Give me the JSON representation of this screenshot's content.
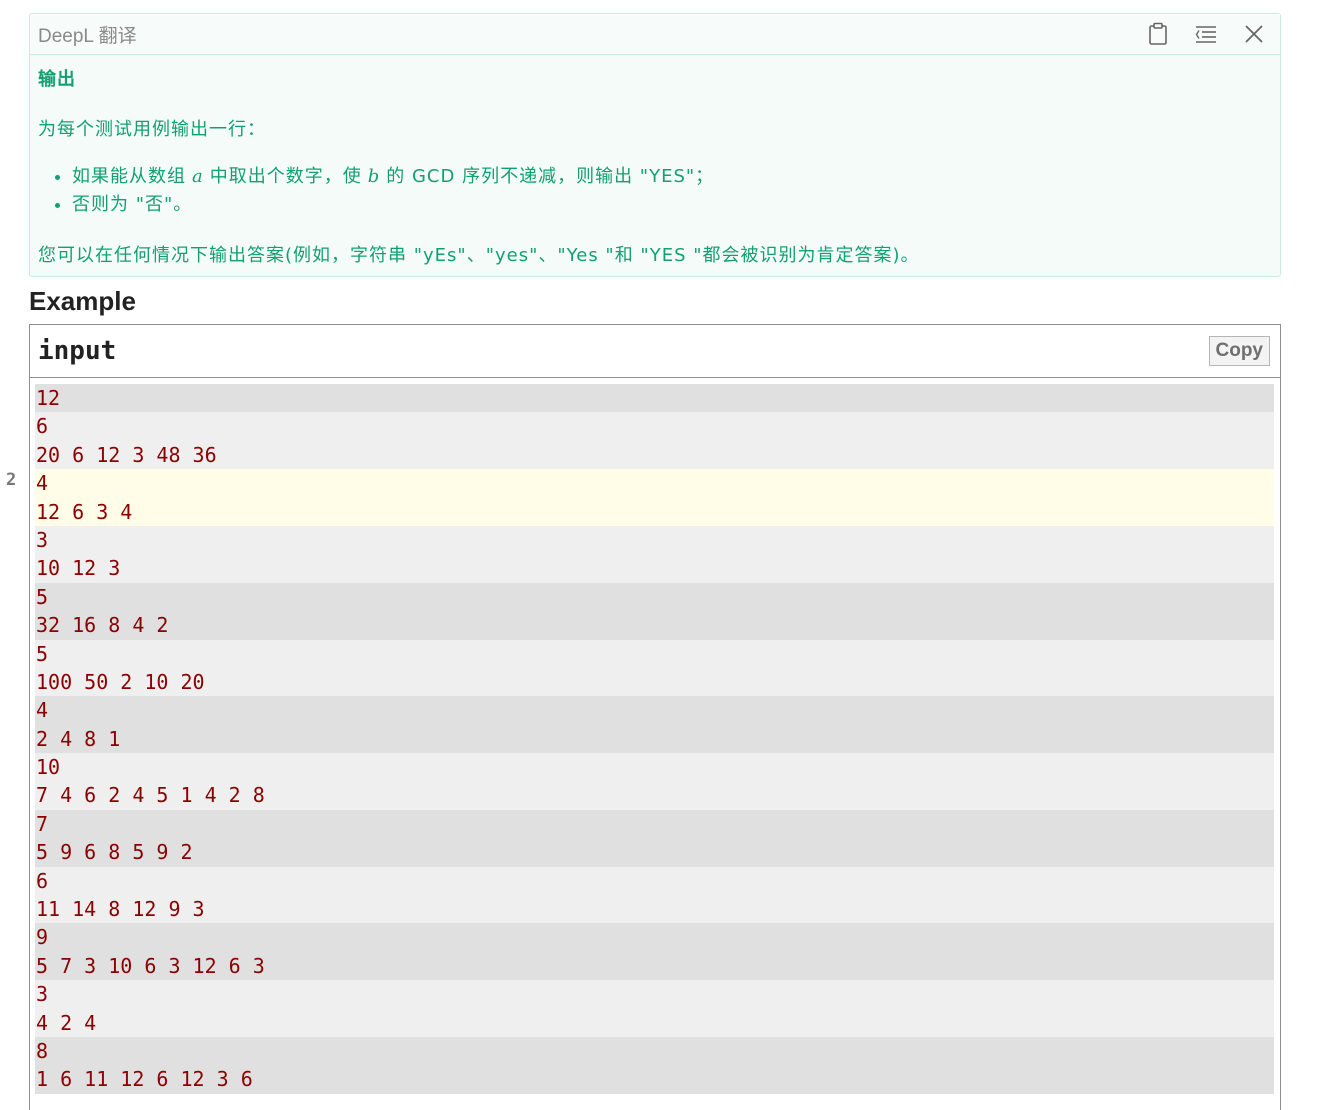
{
  "deepl": {
    "title": "DeepL 翻译",
    "section_title": "输出",
    "intro": "为每个测试用例输出一行：",
    "bullets": {
      "b1_pre": "如果能从数组",
      "b1_var_a": "a",
      "b1_mid": "中取出个数字，使",
      "b1_var_b": "b",
      "b1_post": "的 GCD 序列不递减，则输出 \"YES\"；",
      "b2": "否则为 \"否\"。"
    },
    "note": "您可以在任何情况下输出答案(例如，字符串 \"yEs\"、\"yes\"、\"Yes \"和 \"YES \"都会被识别为肯定答案)。",
    "icons": [
      "clipboard-icon",
      "lines-menu-icon",
      "close-icon"
    ]
  },
  "example": {
    "heading": "Example",
    "input_title": "input",
    "copy_label": "Copy",
    "gutter_label": "2",
    "lines": [
      "12",
      "6",
      "20 6 12 3 48 36",
      "4",
      "12 6 3 4",
      "3",
      "10 12 3",
      "5",
      "32 16 8 4 2",
      "5",
      "100 50 2 10 20",
      "4",
      "2 4 8 1",
      "10",
      "7 4 6 2 4 5 1 4 2 8",
      "7",
      "5 9 6 8 5 9 2",
      "6",
      "11 14 8 12 9 3",
      "9",
      "5 7 3 10 6 3 12 6 3",
      "3",
      "4 2 4",
      "8",
      "1 6 11 12 6 12 3 6"
    ]
  },
  "colors": {
    "deepl_text": "#12a071",
    "input_text": "#8b0000",
    "testcase_odd": "#e0e0e0",
    "testcase_even": "#efefef",
    "testcase_highlight": "#fffde8"
  }
}
